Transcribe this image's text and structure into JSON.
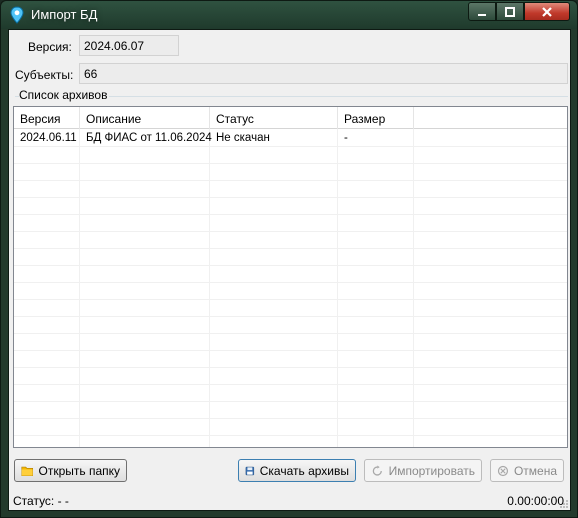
{
  "window": {
    "title": "Импорт БД",
    "min_label": "minimize",
    "max_label": "maximize",
    "close_label": "close"
  },
  "info": {
    "version_label": "Версия:",
    "version_value": "2024.06.07",
    "subjects_label": "Субъекты:",
    "subjects_value": "66"
  },
  "archives": {
    "group_title": "Список архивов",
    "columns": [
      "Версия",
      "Описание",
      "Статус",
      "Размер"
    ],
    "rows": [
      [
        "2024.06.11",
        "БД ФИАС от 11.06.2024",
        "Не скачан",
        "-"
      ]
    ]
  },
  "buttons": {
    "open_folder": "Открыть папку",
    "download": "Скачать архивы",
    "import": "Импортировать",
    "cancel": "Отмена"
  },
  "status": {
    "label": "Статус: - -",
    "time": "0.00:00:00"
  },
  "icons": {
    "app": "map-pin-icon",
    "open_folder": "folder-icon",
    "download": "floppy-disk-icon",
    "import": "refresh-icon",
    "cancel": "cancel-icon"
  },
  "colors": {
    "title_bar": "#2f5240",
    "close_button": "#c0392b",
    "folder": "#f5b800",
    "floppy": "#3a6fb0"
  }
}
